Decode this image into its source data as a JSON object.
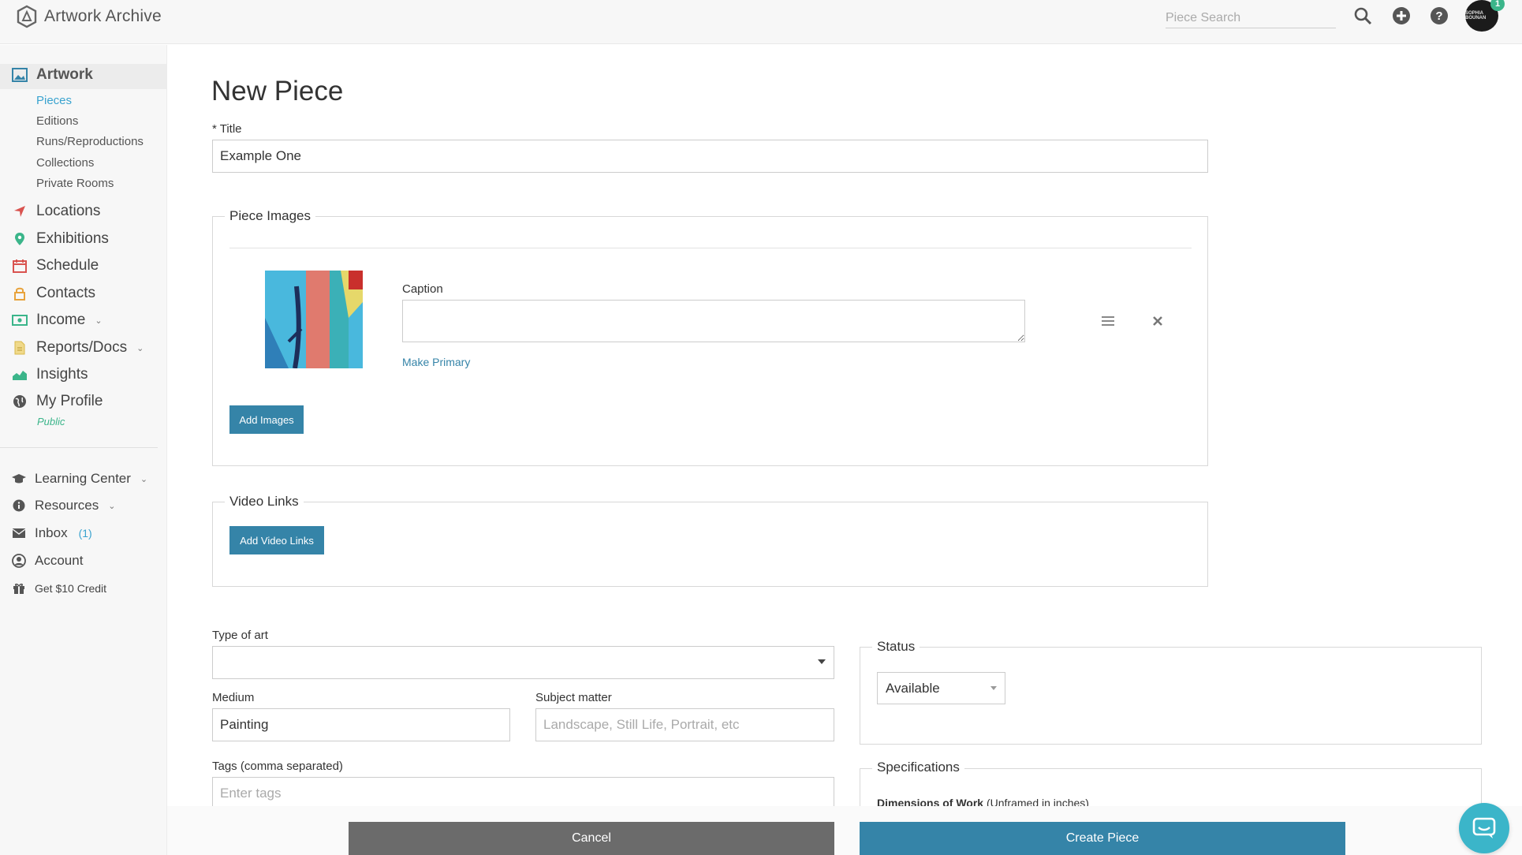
{
  "app": {
    "name": "Artwork Archive"
  },
  "topbar": {
    "search_placeholder": "Piece Search",
    "avatar_text": "SOPHIA BOUNAN",
    "notification_count": "1"
  },
  "sidebar": {
    "artwork_label": "Artwork",
    "sub_items": [
      "Pieces",
      "Editions",
      "Runs/Reproductions",
      "Collections",
      "Private Rooms"
    ],
    "items": [
      "Locations",
      "Exhibitions",
      "Schedule",
      "Contacts",
      "Income",
      "Reports/Docs",
      "Insights",
      "My Profile"
    ],
    "public_label": "Public",
    "secondary": {
      "learning_center": "Learning Center",
      "resources": "Resources",
      "inbox": "Inbox",
      "inbox_count": "(1)",
      "account": "Account",
      "credit": "Get $10 Credit"
    }
  },
  "form": {
    "page_title": "New Piece",
    "title_label": "* Title",
    "title_value": "Example One",
    "piece_images_legend": "Piece Images",
    "caption_label": "Caption",
    "caption_value": "",
    "make_primary": "Make Primary",
    "add_images": "Add Images",
    "video_links_legend": "Video Links",
    "add_video_links": "Add Video Links",
    "type_of_art_label": "Type of art",
    "type_of_art_value": "",
    "medium_label": "Medium",
    "medium_value": "Painting",
    "subject_label": "Subject matter",
    "subject_placeholder": "Landscape, Still Life, Portrait, etc",
    "tags_label": "Tags (comma separated)",
    "tags_placeholder": "Enter tags",
    "status_legend": "Status",
    "status_value": "Available",
    "specifications_legend": "Specifications",
    "dimensions_label": "Dimensions of Work",
    "dimensions_note": "(Unframed in inches)"
  },
  "actions": {
    "cancel": "Cancel",
    "create": "Create Piece"
  },
  "colors": {
    "accent": "#3584a8",
    "link_active": "#3aa3cf",
    "public_green": "#3bb58a",
    "cancel_gray": "#6b6b6b"
  }
}
